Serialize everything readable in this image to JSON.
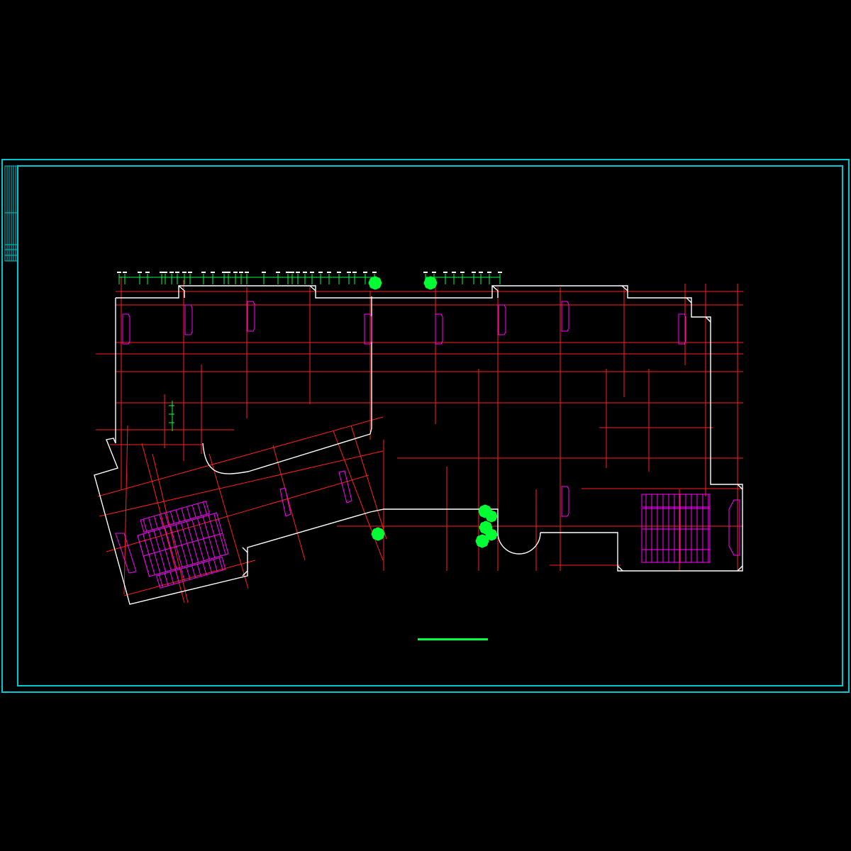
{
  "drawing": {
    "colors": {
      "background": "#000000",
      "frame": "#00c8d0",
      "walls": "#ffffff",
      "axes": "#ff1f1f",
      "furniture": "#ff00ff",
      "dimensions": "#00ff40",
      "trees": "#00ff33"
    },
    "elements": [
      "drawing-frame",
      "title-block-strip",
      "building-outline",
      "axis-grid",
      "stair-left",
      "stair-right",
      "dimension-chain",
      "tree-symbols",
      "scale-bar"
    ]
  }
}
